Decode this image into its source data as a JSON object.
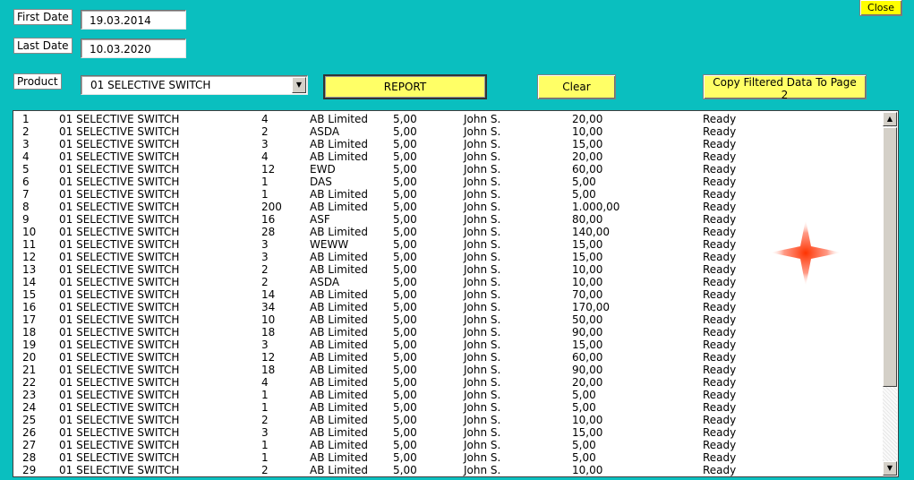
{
  "form": {
    "first_date_label": "First Date",
    "first_date_value": "19.03.2014",
    "last_date_label": "Last Date",
    "last_date_value": "10.03.2020",
    "product_label": "Product",
    "product_value": "01 SELECTIVE SWITCH"
  },
  "buttons": {
    "report": "REPORT",
    "clear": "Clear",
    "copy": "Copy Filtered Data To Page 2",
    "close": "Close"
  },
  "icons": {
    "combo_arrow": "chevron-down-icon",
    "scroll_up": "scroll-up-icon",
    "scroll_down": "scroll-down-icon"
  },
  "colors": {
    "background": "#0abfbf",
    "button": "#ffff66",
    "close_button": "#ffff00"
  },
  "rows": [
    [
      "1",
      "01 SELECTIVE SWITCH",
      "4",
      "AB Limited",
      "5,00",
      "John S.",
      "20,00",
      "Ready"
    ],
    [
      "2",
      "01 SELECTIVE SWITCH",
      "2",
      "ASDA",
      "5,00",
      "John S.",
      "10,00",
      "Ready"
    ],
    [
      "3",
      "01 SELECTIVE SWITCH",
      "3",
      "AB Limited",
      "5,00",
      "John S.",
      "15,00",
      "Ready"
    ],
    [
      "4",
      "01 SELECTIVE SWITCH",
      "4",
      "AB Limited",
      "5,00",
      "John S.",
      "20,00",
      "Ready"
    ],
    [
      "5",
      "01 SELECTIVE SWITCH",
      "12",
      "EWD",
      "5,00",
      "John S.",
      "60,00",
      "Ready"
    ],
    [
      "6",
      "01 SELECTIVE SWITCH",
      "1",
      "DAS",
      "5,00",
      "John S.",
      "5,00",
      "Ready"
    ],
    [
      "7",
      "01 SELECTIVE SWITCH",
      "1",
      "AB Limited",
      "5,00",
      "John S.",
      "5,00",
      "Ready"
    ],
    [
      "8",
      "01 SELECTIVE SWITCH",
      "200",
      "AB Limited",
      "5,00",
      "John S.",
      "1.000,00",
      "Ready"
    ],
    [
      "9",
      "01 SELECTIVE SWITCH",
      "16",
      "ASF",
      "5,00",
      "John S.",
      "80,00",
      "Ready"
    ],
    [
      "10",
      "01 SELECTIVE SWITCH",
      "28",
      "AB Limited",
      "5,00",
      "John S.",
      "140,00",
      "Ready"
    ],
    [
      "11",
      "01 SELECTIVE SWITCH",
      "3",
      "WEWW",
      "5,00",
      "John S.",
      "15,00",
      "Ready"
    ],
    [
      "12",
      "01 SELECTIVE SWITCH",
      "3",
      "AB Limited",
      "5,00",
      "John S.",
      "15,00",
      "Ready"
    ],
    [
      "13",
      "01 SELECTIVE SWITCH",
      "2",
      "AB Limited",
      "5,00",
      "John S.",
      "10,00",
      "Ready"
    ],
    [
      "14",
      "01 SELECTIVE SWITCH",
      "2",
      "ASDA",
      "5,00",
      "John S.",
      "10,00",
      "Ready"
    ],
    [
      "15",
      "01 SELECTIVE SWITCH",
      "14",
      "AB Limited",
      "5,00",
      "John S.",
      "70,00",
      "Ready"
    ],
    [
      "16",
      "01 SELECTIVE SWITCH",
      "34",
      "AB Limited",
      "5,00",
      "John S.",
      "170,00",
      "Ready"
    ],
    [
      "17",
      "01 SELECTIVE SWITCH",
      "10",
      "AB Limited",
      "5,00",
      "John S.",
      "50,00",
      "Ready"
    ],
    [
      "18",
      "01 SELECTIVE SWITCH",
      "18",
      "AB Limited",
      "5,00",
      "John S.",
      "90,00",
      "Ready"
    ],
    [
      "19",
      "01 SELECTIVE SWITCH",
      "3",
      "AB Limited",
      "5,00",
      "John S.",
      "15,00",
      "Ready"
    ],
    [
      "20",
      "01 SELECTIVE SWITCH",
      "12",
      "AB Limited",
      "5,00",
      "John S.",
      "60,00",
      "Ready"
    ],
    [
      "21",
      "01 SELECTIVE SWITCH",
      "18",
      "AB Limited",
      "5,00",
      "John S.",
      "90,00",
      "Ready"
    ],
    [
      "22",
      "01 SELECTIVE SWITCH",
      "4",
      "AB Limited",
      "5,00",
      "John S.",
      "20,00",
      "Ready"
    ],
    [
      "23",
      "01 SELECTIVE SWITCH",
      "1",
      "AB Limited",
      "5,00",
      "John S.",
      "5,00",
      "Ready"
    ],
    [
      "24",
      "01 SELECTIVE SWITCH",
      "1",
      "AB Limited",
      "5,00",
      "John S.",
      "5,00",
      "Ready"
    ],
    [
      "25",
      "01 SELECTIVE SWITCH",
      "2",
      "AB Limited",
      "5,00",
      "John S.",
      "10,00",
      "Ready"
    ],
    [
      "26",
      "01 SELECTIVE SWITCH",
      "3",
      "AB Limited",
      "5,00",
      "John S.",
      "15,00",
      "Ready"
    ],
    [
      "27",
      "01 SELECTIVE SWITCH",
      "1",
      "AB Limited",
      "5,00",
      "John S.",
      "5,00",
      "Ready"
    ],
    [
      "28",
      "01 SELECTIVE SWITCH",
      "1",
      "AB Limited",
      "5,00",
      "John S.",
      "5,00",
      "Ready"
    ],
    [
      "29",
      "01 SELECTIVE SWITCH",
      "2",
      "AB Limited",
      "5,00",
      "John S.",
      "10,00",
      "Ready"
    ]
  ]
}
